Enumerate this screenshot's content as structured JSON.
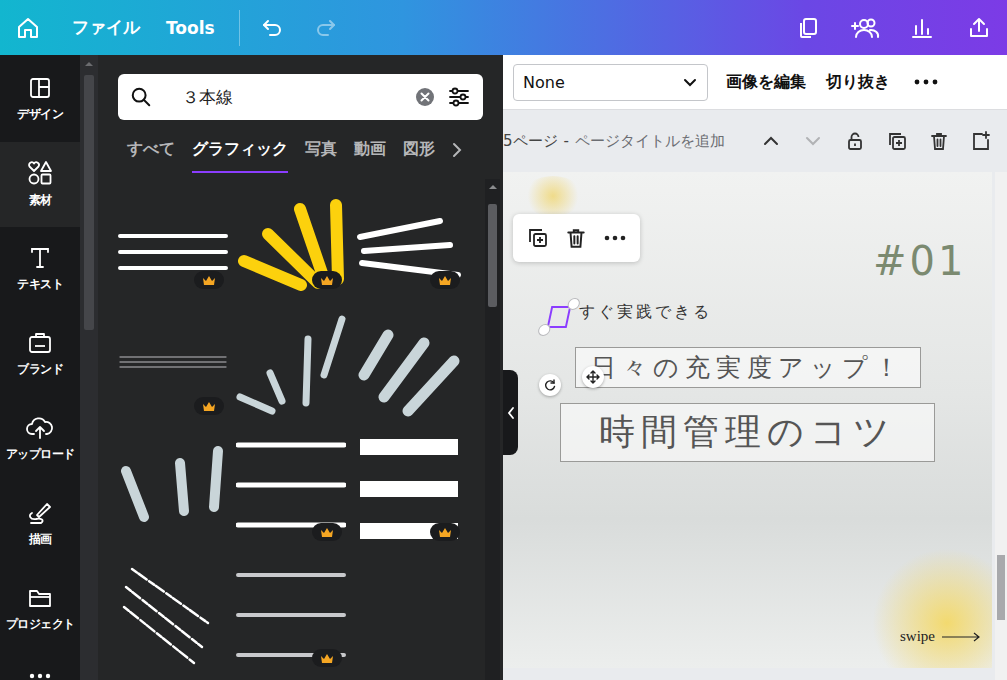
{
  "topbar": {
    "menu": [
      {
        "label": "ファイル"
      },
      {
        "label": "Tools"
      }
    ],
    "undo_enabled": true,
    "redo_enabled": false
  },
  "sidebar": {
    "items": [
      {
        "label": "デザイン",
        "selected": false
      },
      {
        "label": "素材",
        "selected": true
      },
      {
        "label": "テキスト",
        "selected": false
      },
      {
        "label": "ブランド",
        "selected": false
      },
      {
        "label": "アップロード",
        "selected": false
      },
      {
        "label": "描画",
        "selected": false
      },
      {
        "label": "プロジェクト",
        "selected": false
      }
    ]
  },
  "panel": {
    "search": {
      "value": "３本線"
    },
    "tabs": [
      {
        "label": "すべて",
        "selected": false
      },
      {
        "label": "グラフィック",
        "selected": true
      },
      {
        "label": "写真",
        "selected": false
      },
      {
        "label": "動画",
        "selected": false
      },
      {
        "label": "図形",
        "selected": false
      }
    ],
    "results": [
      {
        "kind": "lines",
        "premium": true
      },
      {
        "kind": "burst",
        "premium": true
      },
      {
        "kind": "brush",
        "premium": true
      },
      {
        "kind": "thin-lines",
        "premium": true
      },
      {
        "kind": "rays",
        "premium": false
      },
      {
        "kind": "slashes",
        "premium": false
      },
      {
        "kind": "strokes",
        "premium": false
      },
      {
        "kind": "bars",
        "premium": true
      },
      {
        "kind": "blocks",
        "premium": true
      },
      {
        "kind": "scratch",
        "premium": false
      },
      {
        "kind": "grey-lines",
        "premium": true
      }
    ]
  },
  "toolbar": {
    "font": "None",
    "buttons": [
      {
        "label": "画像を編集"
      },
      {
        "label": "切り抜き"
      }
    ]
  },
  "page": {
    "label": "5ページ",
    "separator": "-",
    "title": "ページタイトルを追加",
    "move_up_enabled": true,
    "move_down_enabled": false
  },
  "design": {
    "number": "#01",
    "tagline": "すぐ実践できる",
    "subtitle": "日々の充実度アップ！",
    "title": "時間管理のコツ",
    "swipe": "swipe"
  }
}
